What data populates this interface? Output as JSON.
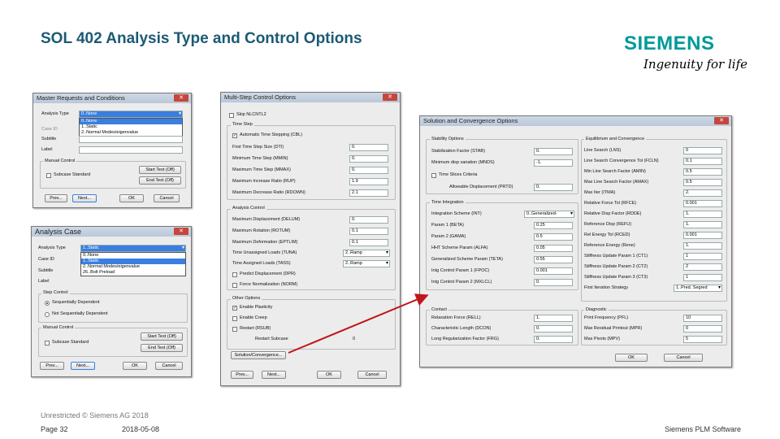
{
  "slide": {
    "title": "SOL 402 Analysis Type and Control Options",
    "brand": "SIEMENS",
    "tagline": "Ingenuity for life",
    "classification": "Unrestricted © Siemens AG 2018",
    "page": "Page 32",
    "date": "2018-05-08",
    "company": "Siemens PLM Software"
  },
  "w1": {
    "title": "Master Requests and Conditions",
    "analysis_type_label": "Analysis Type",
    "analysis_type_value": "0..None",
    "case_id_label": "Case ID",
    "subtitle_label": "Subtitle",
    "label_label": "Label",
    "options": [
      "0..None",
      "1..Static",
      "2..Normal Modes/eigenvalue"
    ],
    "group": "Manual Control",
    "subcase_std": "Subcase Standard",
    "start_text": "Start Text (Off)",
    "end_text": "End Text (Off)",
    "prev": "Prev...",
    "next": "Next...",
    "ok": "OK",
    "cancel": "Cancel"
  },
  "w2": {
    "title": "Analysis Case",
    "analysis_type_label": "Analysis Type",
    "analysis_type_value": "1..Static",
    "case_id_label": "Case ID",
    "subtitle_label": "Subtitle",
    "label_label": "Label",
    "options": [
      "0..None",
      "1..Static",
      "2..Normal Modes/eigenvalue",
      "26..Bolt Preload"
    ],
    "group_step": "Step Control",
    "seq": "Sequentially Dependent",
    "notseq": "Not Sequentially Dependent",
    "group_manual": "Manual Control",
    "subcase_std": "Subcase Standard",
    "start_text": "Start Text (Off)",
    "end_text": "End Text (Off)",
    "prev": "Prev...",
    "next": "Next...",
    "ok": "OK",
    "cancel": "Cancel"
  },
  "w3": {
    "title": "Multi-Step Control Options",
    "skip": "Skip NLCNTL2",
    "time_group": "Time Step",
    "time_rows": [
      {
        "l": "Automatic Time Stepping (CBL)",
        "v": ""
      },
      {
        "l": "First Time Step Size (DTI)",
        "v": "0."
      },
      {
        "l": "Minimum Time Step (MMIN)",
        "v": "0."
      },
      {
        "l": "Maximum Time Step (MMAX)",
        "v": "0."
      },
      {
        "l": "Maximum Increase Ratio (RUP)",
        "v": "1.9"
      },
      {
        "l": "Maximum Decrease Ratio (RDOWN)",
        "v": "2.1"
      }
    ],
    "an_group": "Analysis Control",
    "an_rows": [
      {
        "l": "Maximum Displacement (DELUM)",
        "v": "0."
      },
      {
        "l": "Maximum Rotation (ROTUM)",
        "v": "0.1"
      },
      {
        "l": "Maximum Deformation (EPTLIM)",
        "v": "0.1"
      },
      {
        "l": "Time Unassigned Loads (TUNA)",
        "v": "2..Ramp"
      },
      {
        "l": "Time Assigned Loads (TASS)",
        "v": "2..Ramp"
      }
    ],
    "predict": "Predict Displacement (DPR)",
    "force_norm": "Force Normalization (NORM)",
    "other_group": "Other Options",
    "enable_plast": "Enable Plasticity",
    "enable_creep": "Enable Creep",
    "restart": "Restart (RSUB)",
    "restart_sub": "Restart Subcase",
    "restart_val": "0",
    "sol_conv": "Solution/Convergence...",
    "prev": "Prev...",
    "next": "Next...",
    "ok": "OK",
    "cancel": "Cancel"
  },
  "w4": {
    "title": "Solution and Convergence Options",
    "stab_group": "Stability Options",
    "stab_rows": [
      {
        "l": "Stabilization Factor (STAB)",
        "v": "0."
      },
      {
        "l": "Minimum disp variation (MNDS)",
        "v": "-1."
      }
    ],
    "time_slices": "Time Slices Criteria",
    "allow_disp": "Allowable Displacement (PRTD)",
    "allow_val": "0.",
    "int_group": "Time Integration",
    "int_rows": [
      {
        "l": "Integration Scheme (INT)",
        "v": "0..Generalized-"
      },
      {
        "l": "Param 1 (BETA)",
        "v": "0.25"
      },
      {
        "l": "Param 2 (GAMA)",
        "v": "0.5"
      },
      {
        "l": "HHT Scheme Param (ALFA)",
        "v": "0.05"
      },
      {
        "l": "Generalized Scheme Param (TETA)",
        "v": "0.55"
      },
      {
        "l": "Intg Control Param 1 (FPOC)",
        "v": "0.001"
      },
      {
        "l": "Intg Control Param 2 (MXLCL)",
        "v": "0."
      }
    ],
    "contact_group": "Contact",
    "contact_rows": [
      {
        "l": "Relaxation Force (RELL)",
        "v": "1."
      },
      {
        "l": "Characteristic Length (DCON)",
        "v": "0."
      },
      {
        "l": "Long Regularization Factor (FRG)",
        "v": "0."
      }
    ],
    "eq_group": "Equilibrium and Convergence",
    "eq_rows": [
      {
        "l": "Line Search (LNS)",
        "v": "0"
      },
      {
        "l": "Line Search Convergence Tol (FCLN)",
        "v": "0.1"
      },
      {
        "l": "Min Line Search Factor (AMIN)",
        "v": "0.5"
      },
      {
        "l": "Max Line Search Factor (AMAX)",
        "v": "0.5"
      },
      {
        "l": "Max Iter (ITMA)",
        "v": "2."
      },
      {
        "l": "Relative Force Tol (RFCE)",
        "v": "0.001"
      },
      {
        "l": "Relative Disp Factor (RDDE)",
        "v": "1."
      },
      {
        "l": "Reference Disp (REFU)",
        "v": "1."
      },
      {
        "l": "Rel Energy Tol (RCED)",
        "v": "0.001"
      },
      {
        "l": "Reference Energy (Rene)",
        "v": "1."
      },
      {
        "l": "Stiffness Update Param 1 (CT1)",
        "v": "1"
      },
      {
        "l": "Stiffness Update Param 2 (CT2)",
        "v": "2"
      },
      {
        "l": "Stiffness Update Param 3 (CT3)",
        "v": "1"
      },
      {
        "l": "First Iteration Strategy",
        "v": "1..Pred. Segred"
      }
    ],
    "diag_group": "Diagnostic",
    "diag_rows": [
      {
        "l": "Print Frequency (PFL)",
        "v": "10"
      },
      {
        "l": "Max Residual Printout (MPR)",
        "v": "0"
      },
      {
        "l": "Max Pivots (MPV)",
        "v": "5"
      }
    ],
    "ok": "OK",
    "cancel": "Cancel"
  }
}
